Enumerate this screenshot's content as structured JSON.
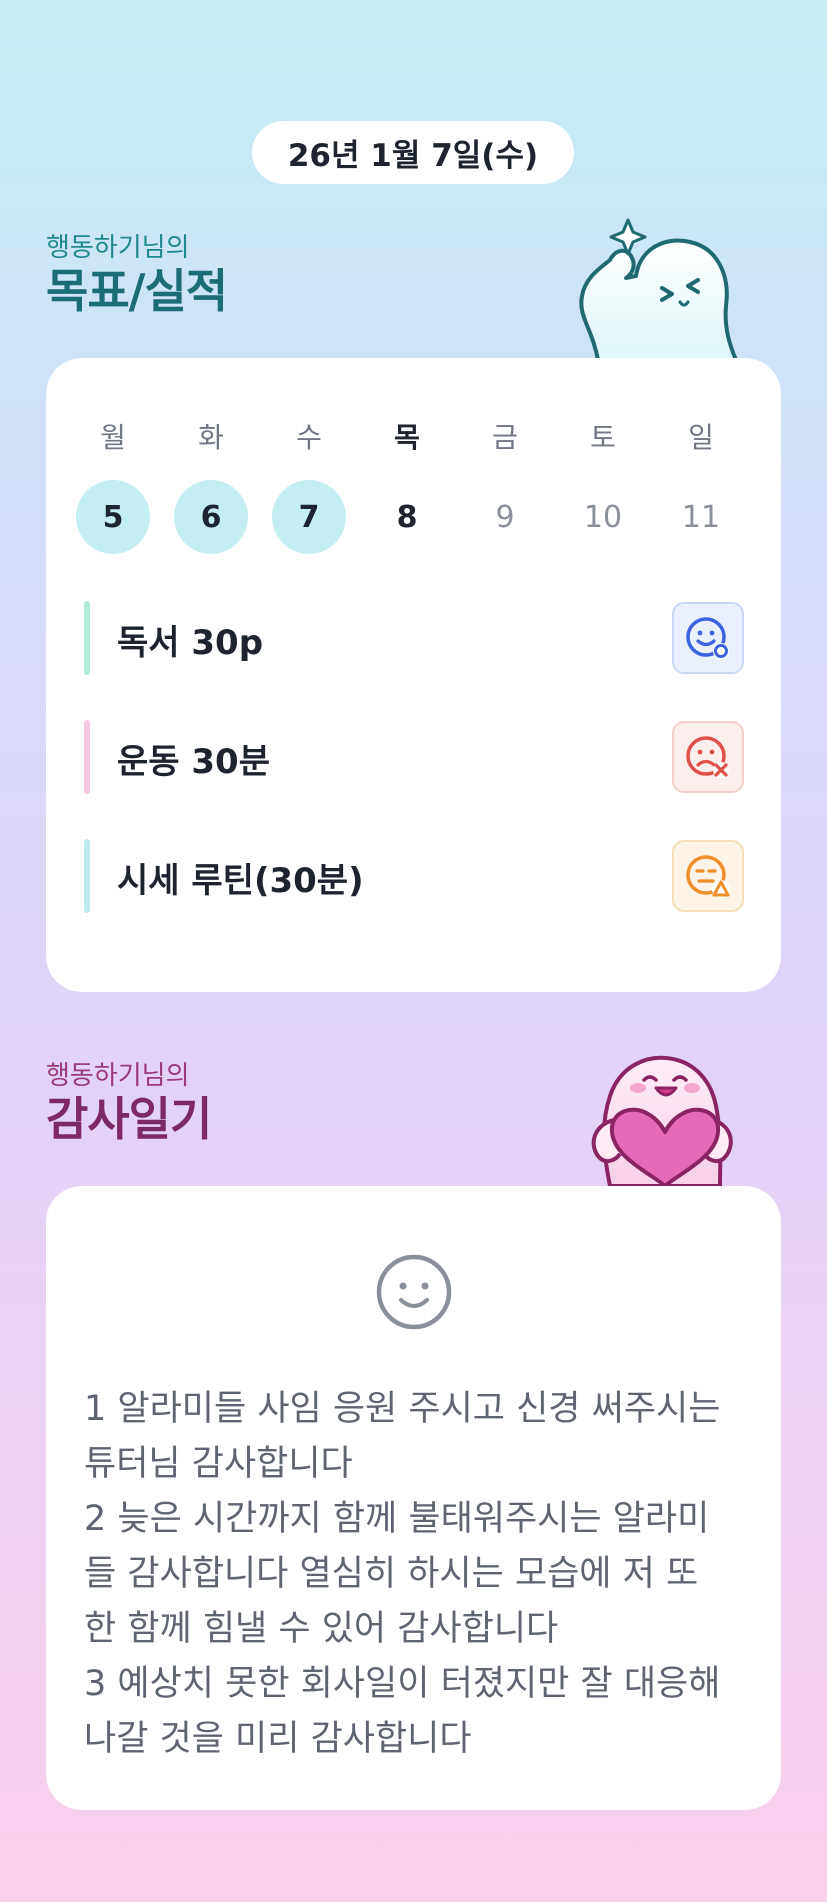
{
  "header": {
    "date": "26년 1월 7일(수)"
  },
  "goal_section": {
    "owner": "행동하기님의",
    "title": "목표/실적"
  },
  "week": {
    "days": [
      {
        "label": "월",
        "num": "5",
        "state": "done"
      },
      {
        "label": "화",
        "num": "6",
        "state": "done"
      },
      {
        "label": "수",
        "num": "7",
        "state": "done"
      },
      {
        "label": "목",
        "num": "8",
        "state": "today"
      },
      {
        "label": "금",
        "num": "9",
        "state": "future"
      },
      {
        "label": "토",
        "num": "10",
        "state": "future"
      },
      {
        "label": "일",
        "num": "11",
        "state": "future"
      }
    ]
  },
  "goals": [
    {
      "text": "독서 30p",
      "bar_color": "#b3ecd6",
      "status": "good",
      "status_icon": "smile-check-icon",
      "icon_color": "#3b63e0"
    },
    {
      "text": "운동 30분",
      "bar_color": "#f6c6e2",
      "status": "bad",
      "status_icon": "sad-x-icon",
      "icon_color": "#e0504a"
    },
    {
      "text": "시세 루틴(30분)",
      "bar_color": "#bfe9f1",
      "status": "mid",
      "status_icon": "neutral-triangle-icon",
      "icon_color": "#ee8f2a"
    }
  ],
  "thanks_section": {
    "owner": "행동하기님의",
    "title": "감사일기"
  },
  "diary": {
    "face_icon": "smiley-icon",
    "text": "1 알라미들 사임 응원 주시고 신경 써주시는\n튜터님 감사합니다\n2 늦은 시간까지 함께 불태워주시는 알라미\n들 감사합니다 열심히 하시는 모습에 저 또\n한 함께 힘낼 수 있어 감사합니다\n3 예상치 못한 회사일이 터졌지만 잘 대응해\n나갈 것을 미리 감사합니다"
  }
}
